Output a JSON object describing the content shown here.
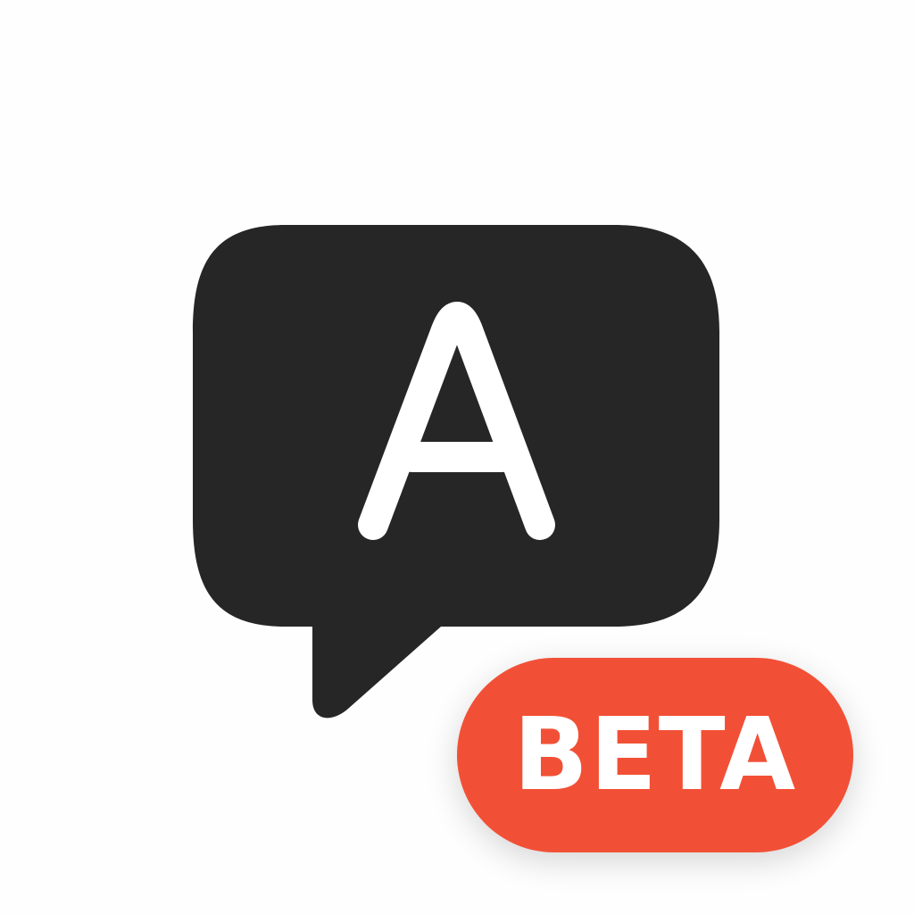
{
  "icon": {
    "glyph": "A",
    "glyph_icon": "letter-a-icon",
    "bubble_icon": "speech-bubble-icon",
    "bubble_color": "#262626",
    "glyph_color": "#ffffff",
    "background_color": "#fefefe"
  },
  "badge": {
    "label": "BETA",
    "color": "#f25036",
    "text_color": "#ffffff"
  }
}
